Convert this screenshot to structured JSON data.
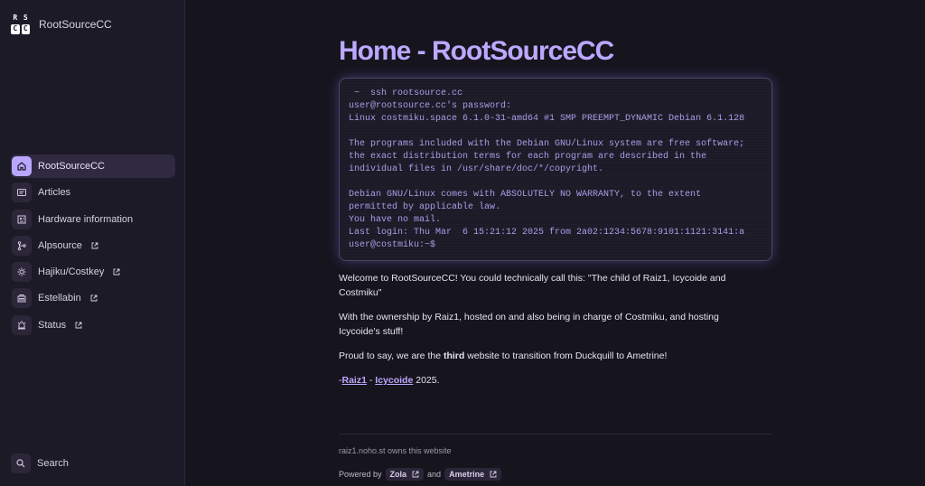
{
  "brand": {
    "name": "RootSourceCC",
    "logo": [
      "R",
      "S",
      "C",
      "C"
    ]
  },
  "nav": [
    {
      "label": "RootSourceCC",
      "icon": "home-icon",
      "external": false,
      "active": true
    },
    {
      "label": "Articles",
      "icon": "articles-icon",
      "external": false
    },
    {
      "label": "Hardware information",
      "icon": "hardware-icon",
      "external": false
    },
    {
      "label": "Alpsource",
      "icon": "git-branch-icon",
      "external": true
    },
    {
      "label": "Hajiku/Costkey",
      "icon": "gear-icon",
      "external": true
    },
    {
      "label": "Estellabin",
      "icon": "bin-icon",
      "external": true
    },
    {
      "label": "Status",
      "icon": "alarm-icon",
      "external": true
    }
  ],
  "search_label": "Search",
  "page": {
    "title": "Home - RootSourceCC"
  },
  "terminal": {
    "lines": [
      " ~  ssh rootsource.cc",
      "user@rootsource.cc's password:",
      "Linux costmiku.space 6.1.0-31-amd64 #1 SMP PREEMPT_DYNAMIC Debian 6.1.128",
      "",
      "The programs included with the Debian GNU/Linux system are free software;",
      "the exact distribution terms for each program are described in the",
      "individual files in /usr/share/doc/*/copyright.",
      "",
      "Debian GNU/Linux comes with ABSOLUTELY NO WARRANTY, to the extent",
      "permitted by applicable law.",
      "You have no mail.",
      "Last login: Thu Mar  6 15:21:12 2025 from 2a02:1234:5678:9101:1121:3141:a",
      "user@costmiku:~$"
    ]
  },
  "content": {
    "p1": "Welcome to RootSourceCC! You could technically call this: \"The child of Raiz1, Icycoide and Costmiku\"",
    "p2": "With the ownership by Raiz1, hosted on and also being in charge of Costmiku, and hosting Icycoide's stuff!",
    "p3_before": "Proud to say, we are the ",
    "p3_bold": "third",
    "p3_after": " website to transition from Duckquill to Ametrine!",
    "sig_dash": "-",
    "sig_link1": "Raiz1",
    "sig_sep": " - ",
    "sig_link2": "Icycoide",
    "sig_year": " 2025."
  },
  "footer": {
    "owns": "raiz1.noho.st owns this website",
    "powered_by": "Powered by",
    "zola": "Zola",
    "and": "and",
    "ametrine": "Ametrine"
  },
  "colors": {
    "accent": "#bba8ff",
    "background": "#16141d",
    "sidebar": "#1d1a28"
  }
}
